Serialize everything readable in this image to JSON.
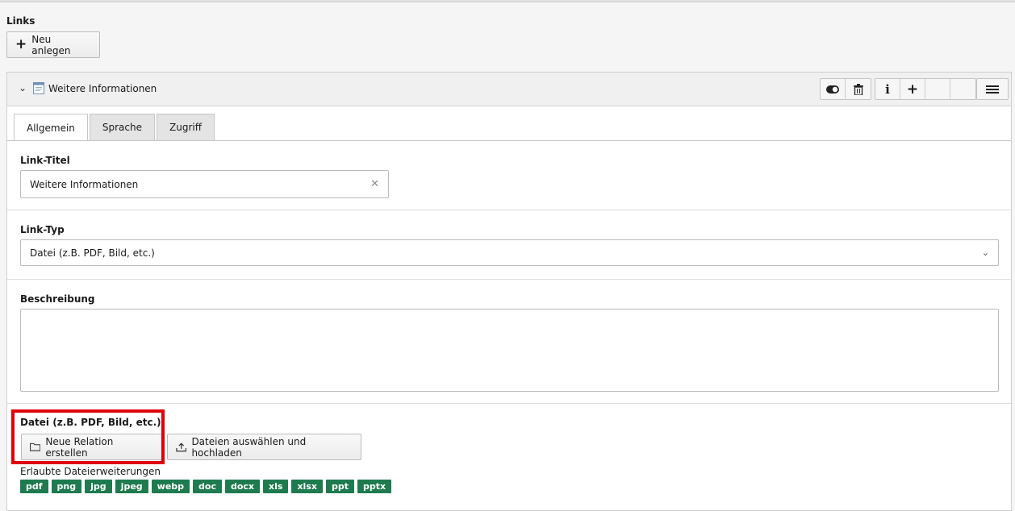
{
  "section_label": "Links",
  "new_button_label": "Neu anlegen",
  "record": {
    "title": "Weitere Informationen",
    "tabs": [
      "Allgemein",
      "Sprache",
      "Zugriff"
    ],
    "active_tab": "Allgemein"
  },
  "fields": {
    "link_title": {
      "label": "Link-Titel",
      "value": "Weitere Informationen"
    },
    "link_type": {
      "label": "Link-Typ",
      "value": "Datei (z.B. PDF, Bild, etc.)"
    },
    "description": {
      "label": "Beschreibung",
      "value": ""
    },
    "file": {
      "label": "Datei (z.B. PDF, Bild, etc.)",
      "new_relation_label": "Neue Relation erstellen",
      "upload_label": "Dateien auswählen und hochladen",
      "allowed_label": "Erlaubte Dateierweiterungen",
      "extensions": [
        "pdf",
        "png",
        "jpg",
        "jpeg",
        "webp",
        "doc",
        "docx",
        "xls",
        "xlsx",
        "ppt",
        "pptx"
      ]
    }
  },
  "colors": {
    "highlight": "#e0000a",
    "extension_badge": "#1e7b4f"
  },
  "icons": {
    "header_actions": [
      "toggle-icon",
      "trash-icon",
      "info-icon",
      "plus-icon",
      "menu-icon"
    ]
  }
}
